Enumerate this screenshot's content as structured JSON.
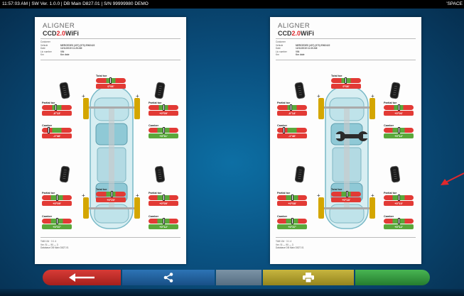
{
  "status_bar": {
    "left_text": "11:57:03 AM  |  SW Ver. 1.0.0  |  DB Main D827.01  |  S/N 99999980 DEMO",
    "right_text": "'SPACE"
  },
  "reports": [
    {
      "logo_line1": "ALIGNER",
      "logo_ccd": "CCD",
      "logo_20": "2.0",
      "logo_wifi": "WiFi",
      "header_rows": [
        {
          "label": "Customer",
          "value": ""
        },
        {
          "label": "Vehicle",
          "value": "MERCEDES (407) (970) E962422"
        },
        {
          "label": "Date",
          "value": "12/11/2019 11:26 AM"
        },
        {
          "label": "Lic number",
          "value": "VIN"
        },
        {
          "label": "Km",
          "value": "Km date"
        }
      ],
      "front_total_toe": {
        "title": "Total toe",
        "value": "0°06'"
      },
      "fl_partial_toe": {
        "title": "Partial toe",
        "value": "-0°13'"
      },
      "fr_partial_toe": {
        "title": "Partial toe",
        "value": "+0°09'"
      },
      "fl_camber": {
        "title": "Camber",
        "value": "-1°48'"
      },
      "fr_camber": {
        "title": "Camber",
        "value": "+0°11'"
      },
      "rear_total_toe": {
        "title": "Total toe",
        "value": "+0°20'"
      },
      "rl_partial_toe": {
        "title": "Partial toe",
        "value": "+0°09'"
      },
      "rr_partial_toe": {
        "title": "Partial toe",
        "value": "+0°09'"
      },
      "rl_camber": {
        "title": "Camber",
        "value": "+0°37'"
      },
      "rr_camber": {
        "title": "Camber",
        "value": "+0°12'"
      },
      "footer_rows": [
        "TAB 134 · 3 1 4",
        "Ver.      SI — 90 — 3",
        "Database   DB Main D827.01"
      ]
    },
    {
      "logo_line1": "ALIGNER",
      "logo_ccd": "CCD",
      "logo_20": "2.0",
      "logo_wifi": "WiFi",
      "header_rows": [
        {
          "label": "Customer",
          "value": ""
        },
        {
          "label": "Vehicle",
          "value": "MERCEDES (407) (970) E962422"
        },
        {
          "label": "Date",
          "value": "12/11/2019 11:30 AM"
        },
        {
          "label": "Lic number",
          "value": "VIN"
        },
        {
          "label": "Km",
          "value": "Km date"
        }
      ],
      "front_total_toe": {
        "title": "Total toe",
        "value": "0°08'"
      },
      "fl_partial_toe": {
        "title": "Partial toe",
        "value": "-0°14'"
      },
      "fr_partial_toe": {
        "title": "Partial toe",
        "value": "+0°06'"
      },
      "fl_camber": {
        "title": "Camber",
        "value": "-1°46'"
      },
      "fr_camber": {
        "title": "Camber",
        "value": "+0°12'"
      },
      "rear_total_toe": {
        "title": "Total toe",
        "value": "+0°18'"
      },
      "rl_partial_toe": {
        "title": "Partial toe",
        "value": "+0°08'"
      },
      "rr_partial_toe": {
        "title": "Partial toe",
        "value": "+0°10'"
      },
      "rl_camber": {
        "title": "Camber",
        "value": "+0°37'"
      },
      "rr_camber": {
        "title": "Camber",
        "value": "+0°12'"
      },
      "footer_rows": [
        "TAB 134 · 3 1 4",
        "Ver.      SI — 90 — 3",
        "Database   DB Main D827.01"
      ]
    }
  ],
  "toolbar": {
    "back_icon": "arrow-left-icon",
    "share_icon": "share-icon",
    "print_icon": "printer-icon",
    "colors": {
      "back": "#d73b36",
      "share": "#2d74b5",
      "gray": "#7b93a6",
      "print": "#c7b53f",
      "next": "#48b552"
    }
  },
  "wrench_icon": "wrench-icon",
  "pointer_arrow_color": "#e0282c"
}
